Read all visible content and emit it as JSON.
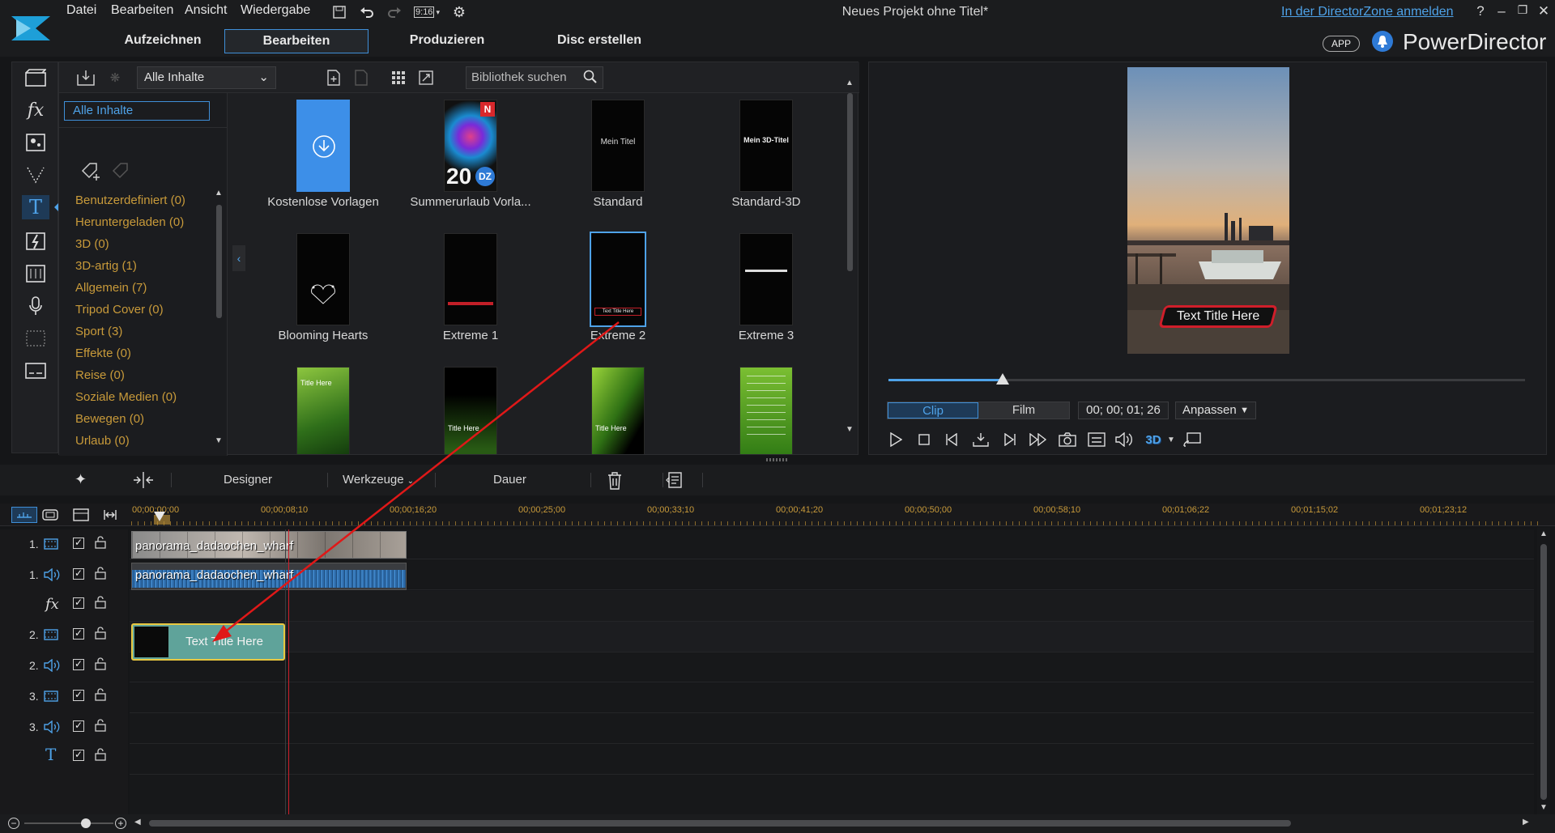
{
  "app": {
    "menu": [
      "Datei",
      "Bearbeiten",
      "Ansicht",
      "Wiedergabe"
    ],
    "aspect": "9:16",
    "project_title": "Neues Projekt ohne Titel*",
    "directorzone_link": "In der DirectorZone anmelden",
    "help": "?",
    "app_badge": "APP",
    "brand": "PowerDirector"
  },
  "modes": [
    {
      "label": "Aufzeichnen",
      "active": false
    },
    {
      "label": "Bearbeiten",
      "active": true
    },
    {
      "label": "Produzieren",
      "active": false
    },
    {
      "label": "Disc erstellen",
      "active": false
    }
  ],
  "library": {
    "content_filter": "Alle Inhalte",
    "search_placeholder": "Bibliothek suchen",
    "selected_category": "Alle Inhalte",
    "categories": [
      "Benutzerdefiniert  (0)",
      "Heruntergeladen  (0)",
      "3D  (0)",
      "3D-artig  (1)",
      "Allgemein  (7)",
      "Tripod Cover  (0)",
      "Sport  (3)",
      "Effekte  (0)",
      "Reise  (0)",
      "Soziale Medien  (0)",
      "Bewegen  (0)",
      "Urlaub  (0)"
    ],
    "templates": [
      {
        "label": "Kostenlose Vorlagen",
        "thumb_text": ""
      },
      {
        "label": "Summerurlaub Vorla...",
        "thumb_text": "20"
      },
      {
        "label": "Standard",
        "thumb_text": "Mein Titel"
      },
      {
        "label": "Standard-3D",
        "thumb_text": "Mein 3D-Titel"
      },
      {
        "label": "Blooming Hearts",
        "thumb_text": ""
      },
      {
        "label": "Extreme 1",
        "thumb_text": ""
      },
      {
        "label": "Extreme 2",
        "thumb_text": "Text Title Here"
      },
      {
        "label": "Extreme 3",
        "thumb_text": ""
      },
      {
        "label": "",
        "thumb_text": "Title Here"
      },
      {
        "label": "",
        "thumb_text": "Title Here"
      },
      {
        "label": "",
        "thumb_text": "Title Here"
      },
      {
        "label": "",
        "thumb_text": ""
      }
    ]
  },
  "preview": {
    "overlay_title": "Text Title Here",
    "mode_clip": "Clip",
    "mode_film": "Film",
    "timecode": "00; 00; 01; 26",
    "fit": "Anpassen",
    "playhead_progress": 0.18,
    "stereo_label": "3D"
  },
  "timeline_toolbar": {
    "designer": "Designer",
    "tools": "Werkzeuge",
    "duration": "Dauer"
  },
  "ruler": [
    "00;00;00;00",
    "00;00;08;10",
    "00;00;16;20",
    "00;00;25;00",
    "00;00;33;10",
    "00;00;41;20",
    "00;00;50;00",
    "00;00;58;10",
    "00;01;06;22",
    "00;01;15;02",
    "00;01;23;12"
  ],
  "tracks": [
    {
      "num": "1.",
      "type": "video"
    },
    {
      "num": "1.",
      "type": "audio"
    },
    {
      "num": "",
      "type": "fx"
    },
    {
      "num": "2.",
      "type": "video"
    },
    {
      "num": "2.",
      "type": "audio"
    },
    {
      "num": "3.",
      "type": "video"
    },
    {
      "num": "3.",
      "type": "audio"
    },
    {
      "num": "",
      "type": "title"
    }
  ],
  "clips": {
    "video1": "panorama_dadaochen_wharf",
    "audio1": "panorama_dadaochen_wharf",
    "title2": "Text Title Here"
  },
  "colors": {
    "accent": "#3f8fd8",
    "category_text": "#c89a3a",
    "drag_arrow": "#e01818",
    "title_clip": "#5fa39a"
  }
}
